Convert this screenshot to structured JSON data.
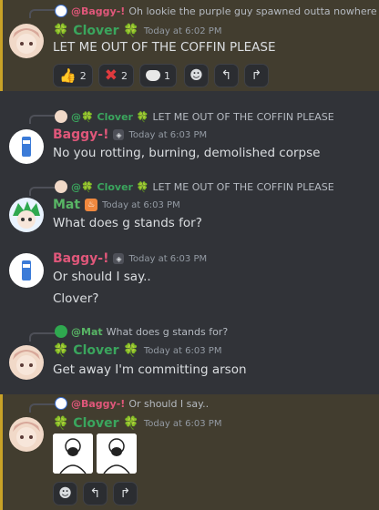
{
  "messages": [
    {
      "reply": {
        "author": "@Baggy-!",
        "text": "Oh lookie the purple guy spawned outta nowhere"
      },
      "author": "🍀 Clover 🍀",
      "timestamp": "Today at 6:02 PM",
      "text": "LET ME OUT OF THE COFFIN PLEASE",
      "reactions": [
        {
          "icon": "thumbs-up-icon",
          "count": "2"
        },
        {
          "icon": "red-x-icon",
          "count": "2"
        },
        {
          "icon": "trollface-icon",
          "count": "1"
        }
      ]
    },
    {
      "reply": {
        "author": "@🍀 Clover 🍀",
        "text": "LET ME OUT OF THE COFFIN PLEASE"
      },
      "author": "Baggy-!",
      "timestamp": "Today at 6:03 PM",
      "text": "No you rotting, burning, demolished corpse"
    },
    {
      "reply": {
        "author": "@🍀 Clover 🍀",
        "text": "LET ME OUT OF THE COFFIN PLEASE"
      },
      "author": "Mat",
      "timestamp": "Today at 6:03 PM",
      "text": "What does g stands for?"
    },
    {
      "author": "Baggy-!",
      "timestamp": "Today at 6:03 PM",
      "lines": [
        "Or should I say..",
        "Clover?"
      ]
    },
    {
      "reply": {
        "author": "@Mat",
        "text": "What does g stands for?"
      },
      "author": "🍀 Clover 🍀",
      "timestamp": "Today at 6:03 PM",
      "text": "Get away I'm committing arson"
    },
    {
      "reply": {
        "author": "@Baggy-!",
        "text": "Or should I say.."
      },
      "author": "🍀 Clover 🍀",
      "timestamp": "Today at 6:03 PM"
    }
  ],
  "colors": {
    "clover": "#3aa55d",
    "baggy": "#e0577a",
    "mat": "#58b565",
    "highlight": "#423d2f"
  }
}
